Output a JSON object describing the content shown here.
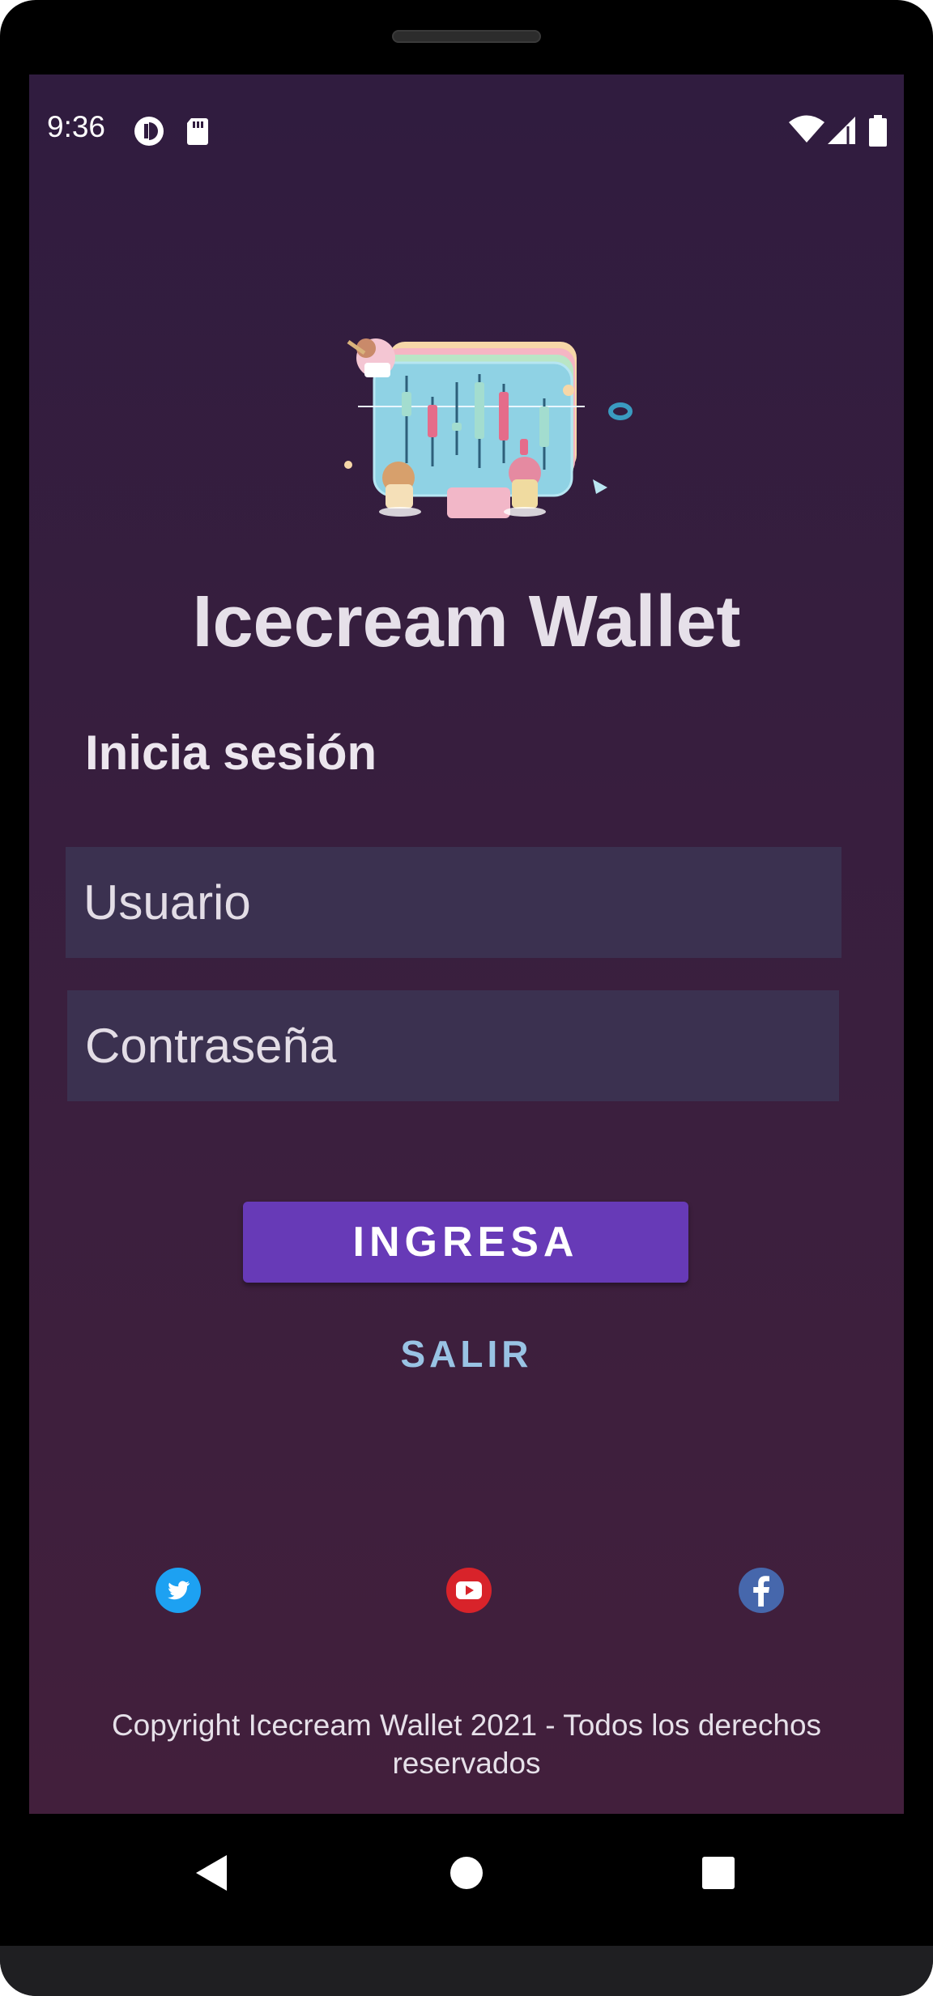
{
  "status_bar": {
    "time": "9:36",
    "left_icons": [
      "data-saver-icon",
      "sd-card-icon"
    ],
    "right_icons": [
      "wifi-icon",
      "cell-signal-icon",
      "battery-icon"
    ]
  },
  "app": {
    "title": "Icecream Wallet",
    "logo_icon": "ice-cream-chart-illustration"
  },
  "login": {
    "heading": "Inicia sesión",
    "username_placeholder": "Usuario",
    "password_placeholder": "Contraseña",
    "submit_label": "INGRESA",
    "exit_label": "SALIR"
  },
  "social": {
    "icons": [
      "twitter-icon",
      "youtube-icon",
      "facebook-icon"
    ]
  },
  "footer": {
    "line1": "Copyright Icecream Wallet 2021 -  Todos los derechos",
    "line2": "reservados"
  },
  "navigation": {
    "buttons": [
      "back-icon",
      "home-icon",
      "recents-icon"
    ]
  },
  "colors": {
    "background_top": "#301c3f",
    "background_bottom": "#421f3c",
    "field_background": "#3b3150",
    "primary_button": "#673ab7",
    "text_button": "#99c3e4"
  }
}
